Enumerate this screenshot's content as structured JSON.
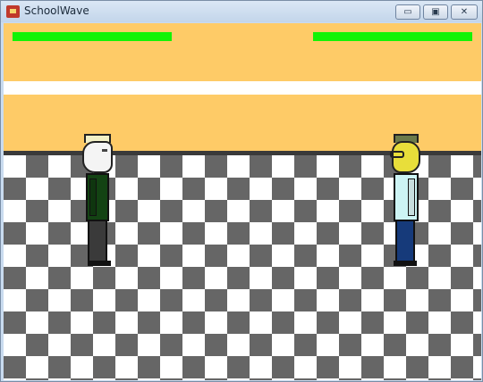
{
  "window": {
    "title": "SchoolWave",
    "controls": {
      "minimize": "▭",
      "maximize": "▣",
      "close": "✕"
    },
    "app_icon": "app-logo-icon"
  },
  "game": {
    "player1": {
      "health": 1.0,
      "bar_color": "#13f306"
    },
    "player2": {
      "health": 1.0,
      "bar_color": "#13f306"
    },
    "colors": {
      "wall": "#fecb67",
      "wall_stripe": "#ffffff",
      "floor_dark": "#666666",
      "floor_light": "#ffffff"
    }
  }
}
